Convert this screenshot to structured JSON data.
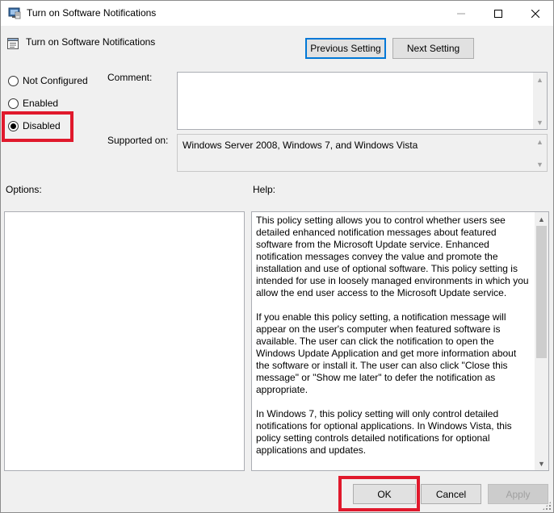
{
  "window": {
    "title": "Turn on Software Notifications"
  },
  "header": {
    "policy_title": "Turn on Software Notifications",
    "prev_label": "Previous Setting",
    "next_label": "Next Setting"
  },
  "state": {
    "options": [
      {
        "label": "Not Configured",
        "selected": false
      },
      {
        "label": "Enabled",
        "selected": false
      },
      {
        "label": "Disabled",
        "selected": true
      }
    ]
  },
  "comment": {
    "label": "Comment:",
    "value": ""
  },
  "supported": {
    "label": "Supported on:",
    "value": "Windows Server 2008, Windows 7, and Windows Vista"
  },
  "options_panel": {
    "label": "Options:"
  },
  "help_panel": {
    "label": "Help:",
    "text": "This policy setting allows you to control whether users see detailed enhanced notification messages about featured software from the Microsoft Update service. Enhanced notification messages convey the value and promote the installation and use of optional software. This policy setting is intended for use in loosely managed environments in which you allow the end user access to the Microsoft Update service.\n\nIf you enable this policy setting, a notification message will appear on the user's computer when featured software is available. The user can click the notification to open the Windows Update Application and get more information about the software or install it. The user can also click \"Close this message\" or \"Show me later\" to defer the notification as appropriate.\n\nIn Windows 7, this policy setting will only control detailed notifications for optional applications. In Windows Vista, this policy setting controls detailed notifications for optional applications and updates."
  },
  "footer": {
    "ok_label": "OK",
    "cancel_label": "Cancel",
    "apply_label": "Apply"
  },
  "colors": {
    "highlight": "#e0192c",
    "accent": "#0078d7"
  }
}
